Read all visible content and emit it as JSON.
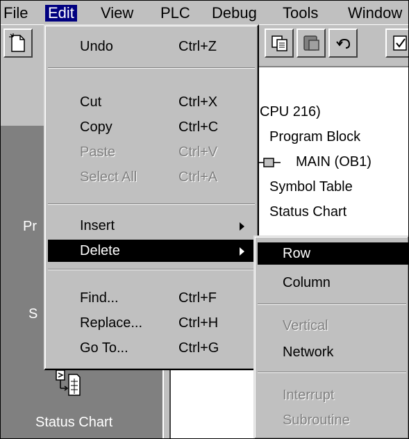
{
  "menubar": {
    "items": [
      {
        "label": "File"
      },
      {
        "label": "Edit"
      },
      {
        "label": "View"
      },
      {
        "label": "PLC"
      },
      {
        "label": "Debug"
      },
      {
        "label": "Tools"
      },
      {
        "label": "Window"
      }
    ]
  },
  "left_pane": {
    "labels": [
      "Pr",
      "S",
      "Status Chart"
    ]
  },
  "tree": {
    "items": [
      "CPU 216)",
      "Program Block",
      "MAIN (OB1)",
      "Symbol Table",
      "Status Chart"
    ]
  },
  "edit_menu": {
    "items": [
      {
        "label": "Undo",
        "shortcut": "Ctrl+Z"
      },
      {
        "label": "Cut",
        "shortcut": "Ctrl+X"
      },
      {
        "label": "Copy",
        "shortcut": "Ctrl+C"
      },
      {
        "label": "Paste",
        "shortcut": "Ctrl+V"
      },
      {
        "label": "Select All",
        "shortcut": "Ctrl+A"
      },
      {
        "label": "Insert",
        "shortcut": ""
      },
      {
        "label": "Delete",
        "shortcut": ""
      },
      {
        "label": "Find...",
        "shortcut": "Ctrl+F"
      },
      {
        "label": "Replace...",
        "shortcut": "Ctrl+H"
      },
      {
        "label": "Go To...",
        "shortcut": "Ctrl+G"
      }
    ]
  },
  "delete_submenu": {
    "items": [
      {
        "label": "Row"
      },
      {
        "label": "Column"
      },
      {
        "label": "Vertical"
      },
      {
        "label": "Network"
      },
      {
        "label": "Interrupt"
      },
      {
        "label": "Subroutine"
      }
    ]
  }
}
